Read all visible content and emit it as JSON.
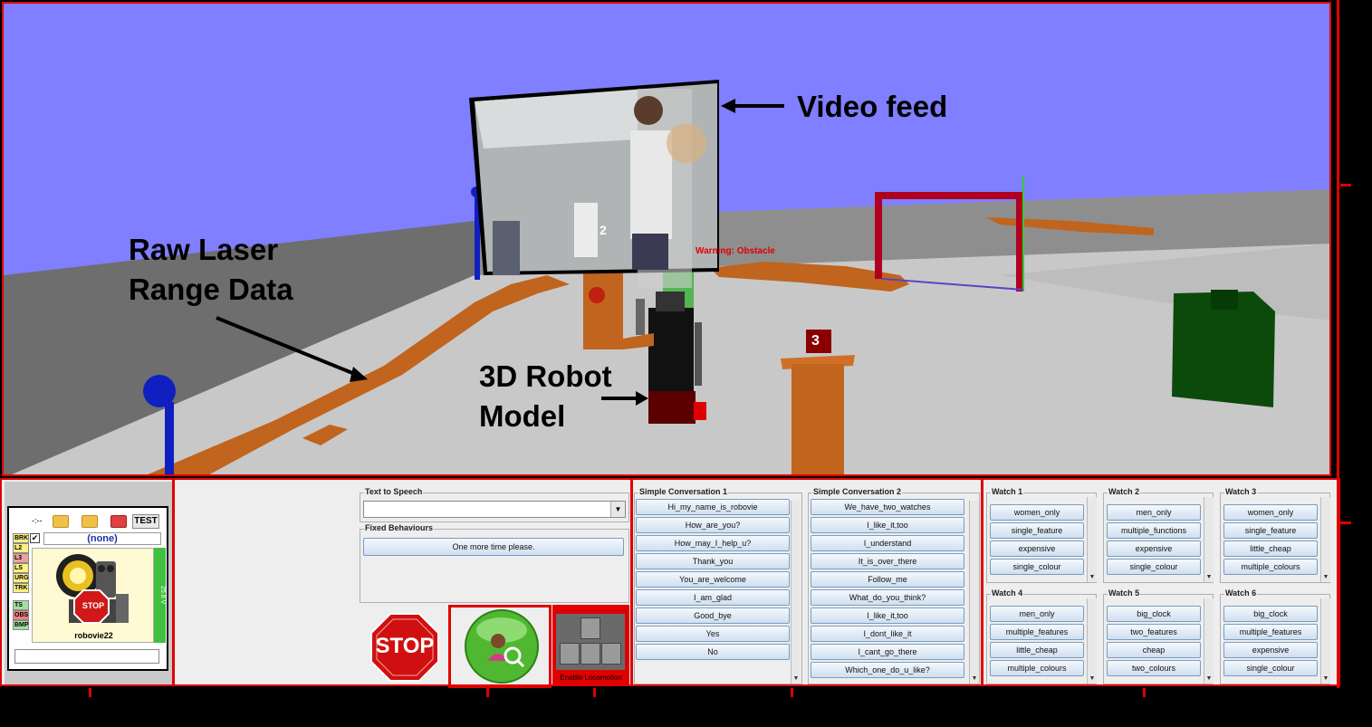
{
  "annotations": {
    "video_feed": "Video feed",
    "laser_line1": "Raw Laser",
    "laser_line2": "Range Data",
    "robot_line1": "3D Robot",
    "robot_line2": "Model",
    "warning": "Warning: Obstacle"
  },
  "scene_markers": {
    "marker2": "2",
    "marker3": "3"
  },
  "status_widget": {
    "time": "-:--",
    "test_label": "TEST",
    "robot_selection": "(none)",
    "robot_name": "robovie22",
    "voltage": "25.8 V",
    "stop_badge": "STOP",
    "flags": [
      "BRK",
      "L2",
      "L3",
      "LS",
      "URG",
      "TRK",
      "TS",
      "OBS",
      "BMP"
    ]
  },
  "text_to_speech": {
    "title": "Text to Speech",
    "value": ""
  },
  "fixed_behaviours": {
    "title": "Fixed Behaviours",
    "items": [
      "One more time please."
    ]
  },
  "stop_button": {
    "label": "STOP"
  },
  "locomotion": {
    "label": "Enable Locomotion"
  },
  "conversation1": {
    "title": "Simple Conversation 1",
    "items": [
      "Hi_my_name_is_robovie",
      "How_are_you?",
      "How_may_I_help_u?",
      "Thank_you",
      "You_are_welcome",
      "I_am_glad",
      "Good_bye",
      "Yes",
      "No"
    ]
  },
  "conversation2": {
    "title": "Simple Conversation 2",
    "items": [
      "We_have_two_watches",
      "I_like_it,too",
      "I_understand",
      "It_is_over_there",
      "Follow_me",
      "What_do_you_think?",
      "I_like_it,too",
      "I_dont_like_it",
      "I_cant_go_there",
      "Which_one_do_u_like?"
    ]
  },
  "watches": [
    {
      "title": "Watch 1",
      "items": [
        "women_only",
        "single_feature",
        "expensive",
        "single_colour"
      ]
    },
    {
      "title": "Watch 2",
      "items": [
        "men_only",
        "multiple_functions",
        "expensive",
        "single_colour"
      ]
    },
    {
      "title": "Watch 3",
      "items": [
        "women_only",
        "single_feature",
        "little_cheap",
        "multiple_colours"
      ]
    },
    {
      "title": "Watch 4",
      "items": [
        "men_only",
        "multiple_features",
        "little_cheap",
        "multiple_colours"
      ]
    },
    {
      "title": "Watch 5",
      "items": [
        "big_clock",
        "two_features",
        "cheap",
        "two_colours"
      ]
    },
    {
      "title": "Watch 6",
      "items": [
        "big_clock",
        "multiple_features",
        "expensive",
        "single_colour"
      ]
    }
  ],
  "colors": {
    "sky": "#7f7fff",
    "floor": "#c8c8c8",
    "laser": "#c0641e",
    "frame_red": "#e00000"
  }
}
